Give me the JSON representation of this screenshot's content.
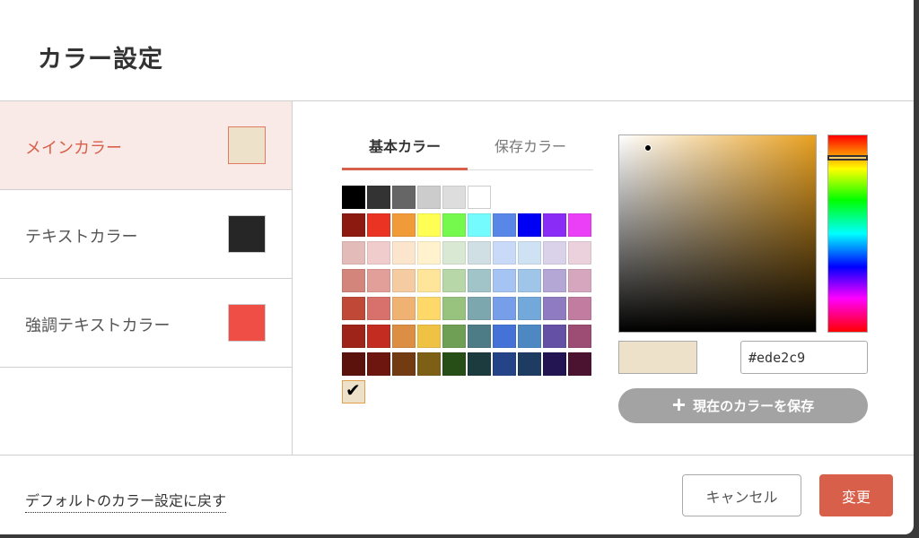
{
  "dialog": {
    "title": "カラー設定"
  },
  "sidebar": {
    "items": [
      {
        "label": "メインカラー",
        "color": "#ede2c9",
        "active": true
      },
      {
        "label": "テキストカラー",
        "color": "#262626",
        "active": false
      },
      {
        "label": "強調テキストカラー",
        "color": "#ee4e45",
        "active": false
      }
    ]
  },
  "tabs": [
    {
      "label": "基本カラー",
      "active": true
    },
    {
      "label": "保存カラー",
      "active": false
    }
  ],
  "palette": {
    "rows": [
      [
        "#000000",
        "#333333",
        "#666666",
        "#cccccc",
        "#dddddd",
        "#ffffff"
      ],
      [
        "#8c1a11",
        "#ea3323",
        "#f19a38",
        "#fefe54",
        "#75f94c",
        "#73fbfd",
        "#5987e8",
        "#0000f5",
        "#8a2cf5",
        "#ea3ff7"
      ],
      [
        "#e3bbb8",
        "#f1cccc",
        "#fbe5cd",
        "#fff2cc",
        "#d9e8d3",
        "#d0dfe3",
        "#c9daf8",
        "#cfe2f3",
        "#d9d2e9",
        "#ead1dc"
      ],
      [
        "#d4857b",
        "#e29f9a",
        "#f5cba1",
        "#ffe59a",
        "#b8d7a8",
        "#a1c4c9",
        "#a5c3f3",
        "#9fc5e8",
        "#b4a7d6",
        "#d5a6bd"
      ],
      [
        "#bf4936",
        "#d8716c",
        "#efb273",
        "#fed96a",
        "#97c37f",
        "#7ca7af",
        "#779ee9",
        "#72a9da",
        "#8f7bc2",
        "#c17c9f"
      ],
      [
        "#9e2318",
        "#c32c20",
        "#dc8e45",
        "#efc244",
        "#6e9f54",
        "#4d7c87",
        "#4472d6",
        "#4d88c3",
        "#6450a5",
        "#9d4d74"
      ],
      [
        "#5c120c",
        "#6d150f",
        "#723b12",
        "#7e5f16",
        "#284e18",
        "#1b3b3f",
        "#254387",
        "#1e3b62",
        "#221552",
        "#4b1330"
      ]
    ],
    "selected_color": "#ede2c9",
    "selected_mark": "✔"
  },
  "picker": {
    "hex_value": "#ede2c9",
    "hue_color": "#e8a020",
    "save_label": "現在のカラーを保存"
  },
  "footer": {
    "reset_label": "デフォルトのカラー設定に戻す",
    "cancel_label": "キャンセル",
    "change_label": "変更"
  }
}
